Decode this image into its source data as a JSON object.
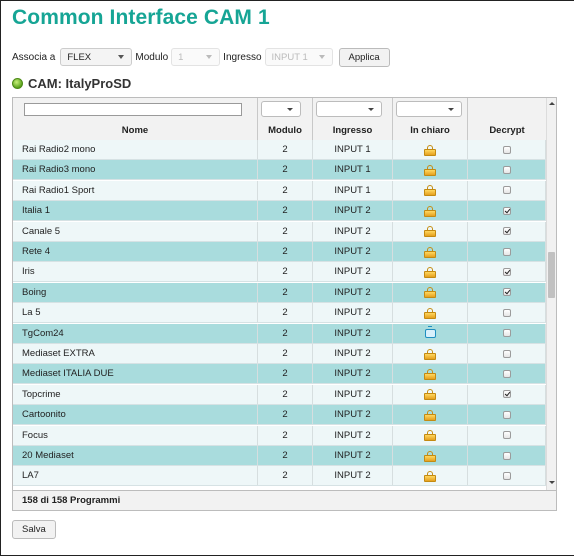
{
  "page": {
    "title": "Common Interface CAM 1"
  },
  "controls": {
    "associa_label": "Associa a",
    "associa_value": "FLEX",
    "modulo_label": "Modulo",
    "modulo_value": "1",
    "ingresso_label": "Ingresso",
    "ingresso_value": "INPUT 1",
    "apply_label": "Applica"
  },
  "cam": {
    "name": "CAM: ItalyProSD",
    "status_color": "#5aa21c"
  },
  "table": {
    "columns": [
      "Nome",
      "Modulo",
      "Ingresso",
      "In chiaro",
      "Decrypt"
    ],
    "rows": [
      {
        "nome": "Rai Radio2 mono",
        "modulo": "2",
        "ingresso": "INPUT 1",
        "icon": "lock-icon",
        "decrypt": false
      },
      {
        "nome": "Rai Radio3 mono",
        "modulo": "2",
        "ingresso": "INPUT 1",
        "icon": "lock-icon",
        "decrypt": false
      },
      {
        "nome": "Rai Radio1 Sport",
        "modulo": "2",
        "ingresso": "INPUT 1",
        "icon": "lock-icon",
        "decrypt": false
      },
      {
        "nome": "Italia 1",
        "modulo": "2",
        "ingresso": "INPUT 2",
        "icon": "lock-icon",
        "decrypt": true
      },
      {
        "nome": "Canale 5",
        "modulo": "2",
        "ingresso": "INPUT 2",
        "icon": "lock-icon",
        "decrypt": true
      },
      {
        "nome": "Rete 4",
        "modulo": "2",
        "ingresso": "INPUT 2",
        "icon": "lock-icon",
        "decrypt": false
      },
      {
        "nome": "Iris",
        "modulo": "2",
        "ingresso": "INPUT 2",
        "icon": "lock-icon",
        "decrypt": true
      },
      {
        "nome": "Boing",
        "modulo": "2",
        "ingresso": "INPUT 2",
        "icon": "lock-icon",
        "decrypt": true
      },
      {
        "nome": "La 5",
        "modulo": "2",
        "ingresso": "INPUT 2",
        "icon": "lock-icon",
        "decrypt": false
      },
      {
        "nome": "TgCom24",
        "modulo": "2",
        "ingresso": "INPUT 2",
        "icon": "tv-icon",
        "decrypt": false
      },
      {
        "nome": "Mediaset EXTRA",
        "modulo": "2",
        "ingresso": "INPUT 2",
        "icon": "lock-icon",
        "decrypt": false
      },
      {
        "nome": "Mediaset ITALIA DUE",
        "modulo": "2",
        "ingresso": "INPUT 2",
        "icon": "lock-icon",
        "decrypt": false
      },
      {
        "nome": "Topcrime",
        "modulo": "2",
        "ingresso": "INPUT 2",
        "icon": "lock-icon",
        "decrypt": true
      },
      {
        "nome": "Cartoonito",
        "modulo": "2",
        "ingresso": "INPUT 2",
        "icon": "lock-icon",
        "decrypt": false
      },
      {
        "nome": "Focus",
        "modulo": "2",
        "ingresso": "INPUT 2",
        "icon": "lock-icon",
        "decrypt": false
      },
      {
        "nome": "20 Mediaset",
        "modulo": "2",
        "ingresso": "INPUT 2",
        "icon": "lock-icon",
        "decrypt": false
      },
      {
        "nome": "LA7",
        "modulo": "2",
        "ingresso": "INPUT 2",
        "icon": "lock-icon",
        "decrypt": false
      }
    ],
    "row_shading": [
      "light",
      "teal",
      "light",
      "teal",
      "light",
      "teal",
      "light",
      "teal",
      "light",
      "teal",
      "light",
      "teal",
      "light",
      "teal",
      "light",
      "teal",
      "light"
    ],
    "footer": "158 di 158 Programmi"
  },
  "actions": {
    "save_label": "Salva"
  },
  "colors": {
    "title": "#16a595",
    "row_teal": "#a9dcdd",
    "row_light": "#eef7f8"
  }
}
